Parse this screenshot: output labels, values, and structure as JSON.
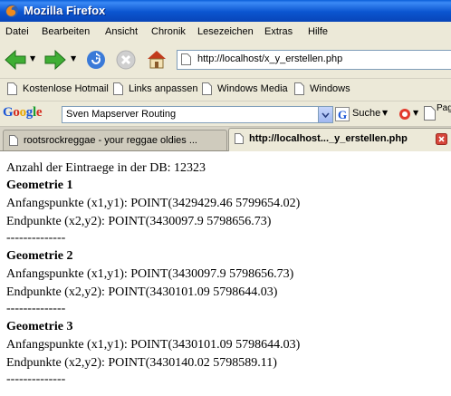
{
  "window": {
    "title": "Mozilla Firefox"
  },
  "menu": [
    "Datei",
    "Bearbeiten",
    "Ansicht",
    "Chronik",
    "Lesezeichen",
    "Extras",
    "Hilfe"
  ],
  "toolbar": {
    "url": "http://localhost/x_y_erstellen.php"
  },
  "bookmarks": [
    "Kostenlose Hotmail",
    "Links anpassen",
    "Windows Media",
    "Windows"
  ],
  "google_bar": {
    "logo": "Google",
    "query": "Sven Mapserver Routing",
    "search_label": "Suche",
    "more_label": "Pag"
  },
  "tabs": [
    {
      "title": "rootsrockreggae - your reggae oldies ..."
    },
    {
      "title": "http://localhost..._y_erstellen.php"
    }
  ],
  "colors": {
    "titlebar": "#0b55d0",
    "google_blue": "#1a55d6",
    "google_red": "#d52b1e",
    "google_yellow": "#e7a600",
    "google_green": "#199c2e"
  },
  "page": {
    "count_line": "Anzahl der Eintraege in der DB: 12323",
    "separator": "--------------",
    "geometries": [
      {
        "heading": "Geometrie 1",
        "start": "Anfangspunkte (x1,y1): POINT(3429429.46 5799654.02)",
        "end": "Endpunkte (x2,y2): POINT(3430097.9 5798656.73)"
      },
      {
        "heading": "Geometrie 2",
        "start": "Anfangspunkte (x1,y1): POINT(3430097.9 5798656.73)",
        "end": "Endpunkte (x2,y2): POINT(3430101.09 5798644.03)"
      },
      {
        "heading": "Geometrie 3",
        "start": "Anfangspunkte (x1,y1): POINT(3430101.09 5798644.03)",
        "end": "Endpunkte (x2,y2): POINT(3430140.02 5798589.11)"
      }
    ]
  }
}
